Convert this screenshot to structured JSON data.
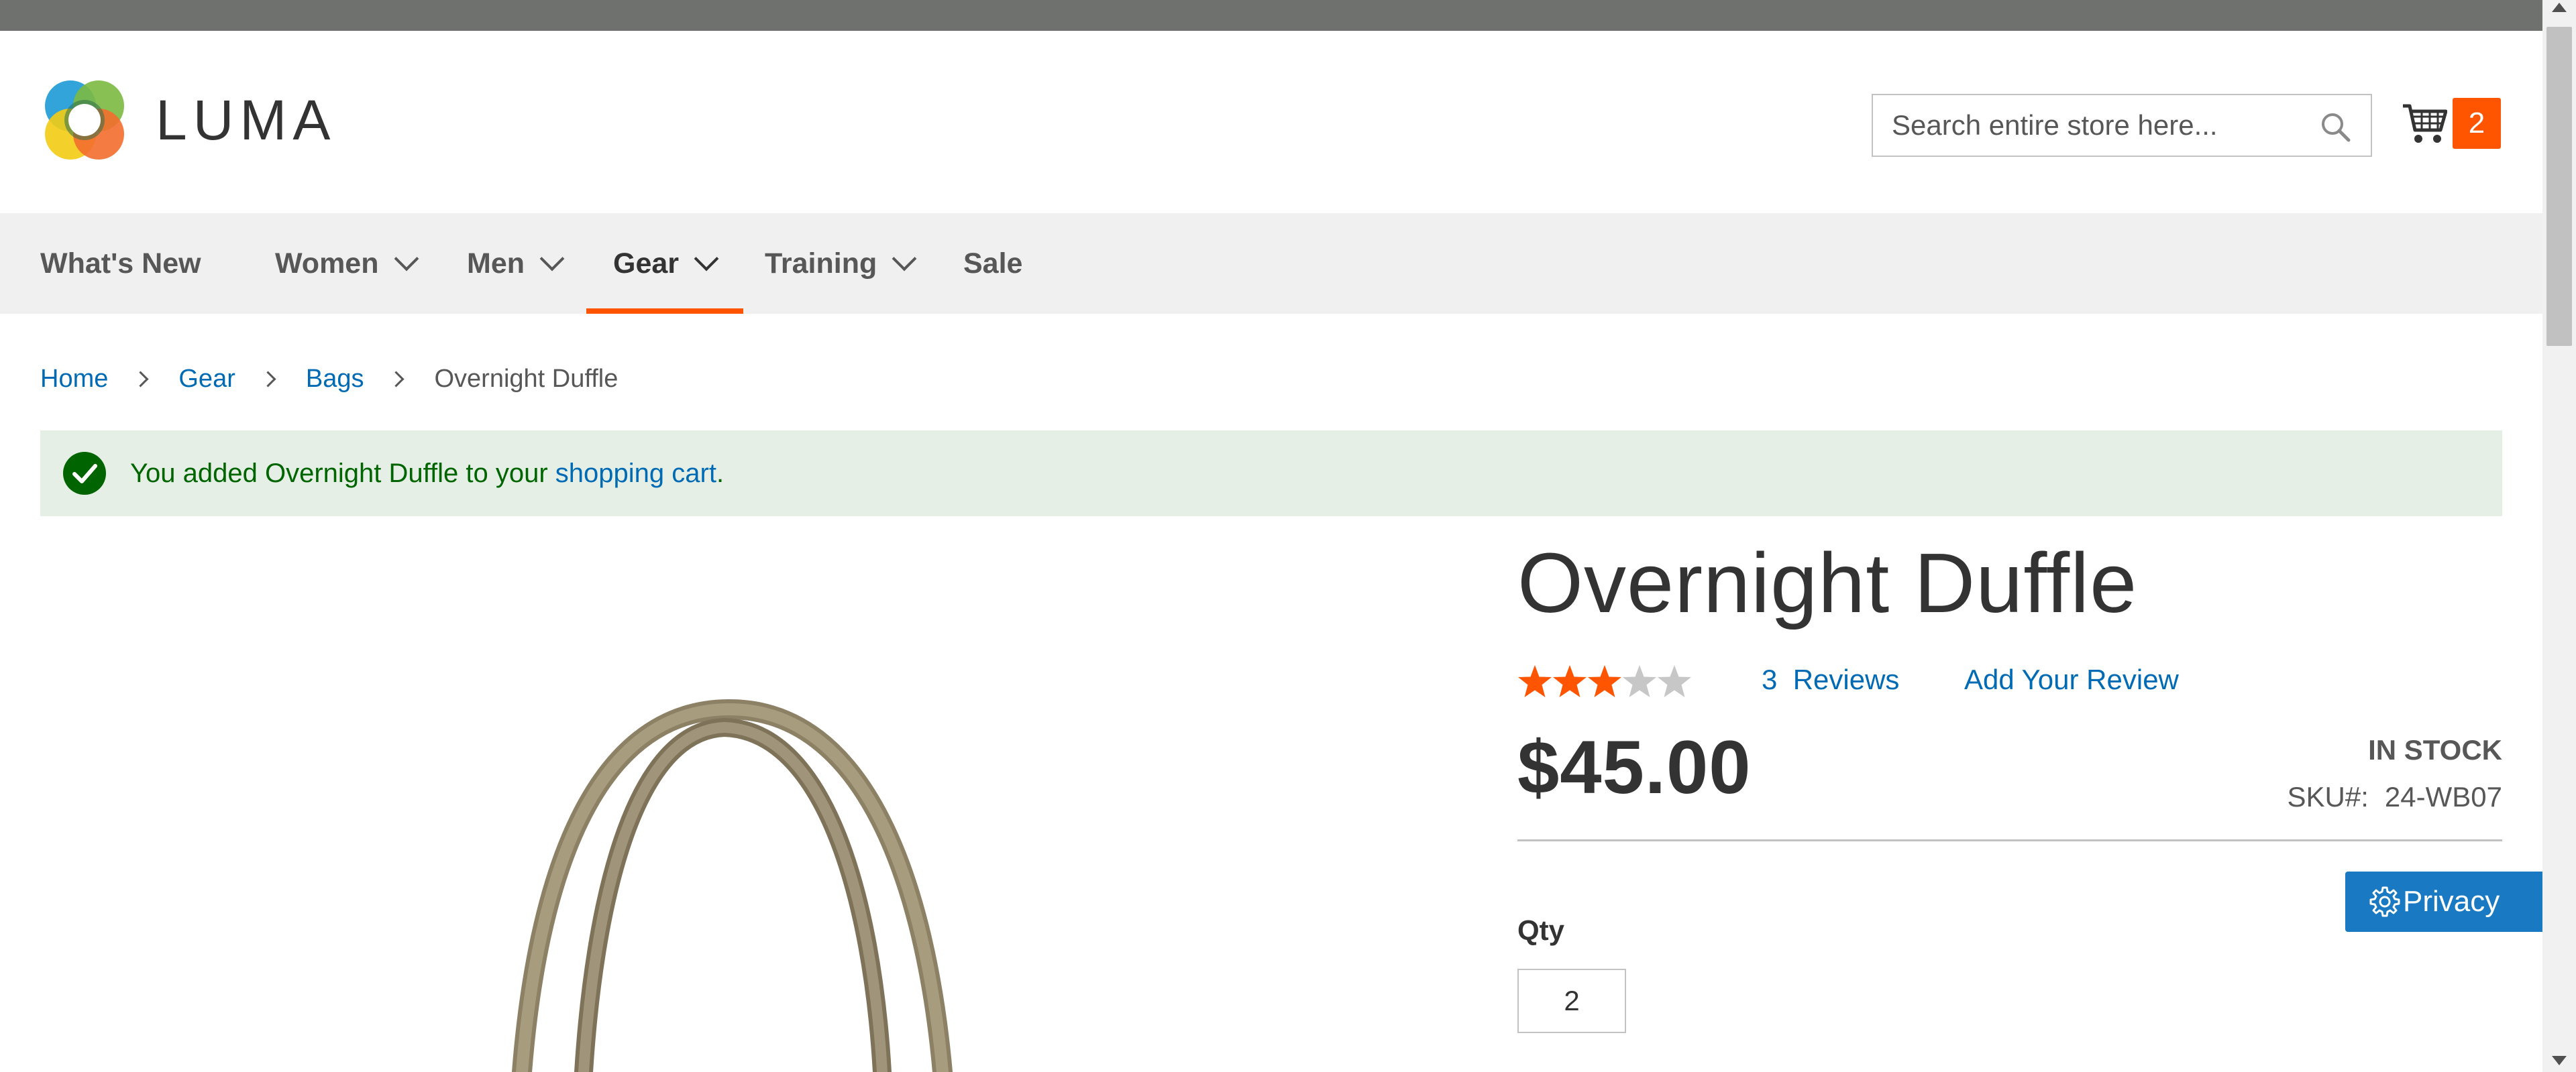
{
  "header": {
    "logo_text": "LUMA",
    "search": {
      "placeholder": "Search entire store here..."
    },
    "cart": {
      "count": "2"
    }
  },
  "nav": {
    "items": [
      {
        "label": "What's New",
        "has_dropdown": false
      },
      {
        "label": "Women",
        "has_dropdown": true
      },
      {
        "label": "Men",
        "has_dropdown": true
      },
      {
        "label": "Gear",
        "has_dropdown": true,
        "active": true
      },
      {
        "label": "Training",
        "has_dropdown": true
      },
      {
        "label": "Sale",
        "has_dropdown": false
      }
    ]
  },
  "breadcrumb": {
    "items": [
      "Home",
      "Gear",
      "Bags"
    ],
    "current": "Overnight Duffle"
  },
  "message": {
    "prefix": "You added Overnight Duffle to your ",
    "link": "shopping cart",
    "suffix": "."
  },
  "product": {
    "title": "Overnight Duffle",
    "rating": 3,
    "rating_max": 5,
    "reviews_count": "3",
    "reviews_label": "Reviews",
    "add_review": "Add Your Review",
    "price": "$45.00",
    "stock": "IN STOCK",
    "sku_label": "SKU#:",
    "sku": "24-WB07",
    "qty_label": "Qty",
    "qty_value": "2"
  },
  "privacy_button": {
    "label": "Privacy"
  },
  "colors": {
    "accent": "#ff5501",
    "link": "#006bb4",
    "success_bg": "#e5efe5",
    "success_text": "#006400",
    "star_on": "#ff5501",
    "star_off": "#c7c7c7",
    "privacy_bg": "#1979c3",
    "topbar": "#6e716e",
    "nav_bg": "#f0f0f0"
  },
  "icons": [
    "search-icon",
    "cart-icon",
    "chevron-down-icon",
    "chevron-right-icon",
    "checkmark-icon",
    "star-icon",
    "gear-icon"
  ]
}
